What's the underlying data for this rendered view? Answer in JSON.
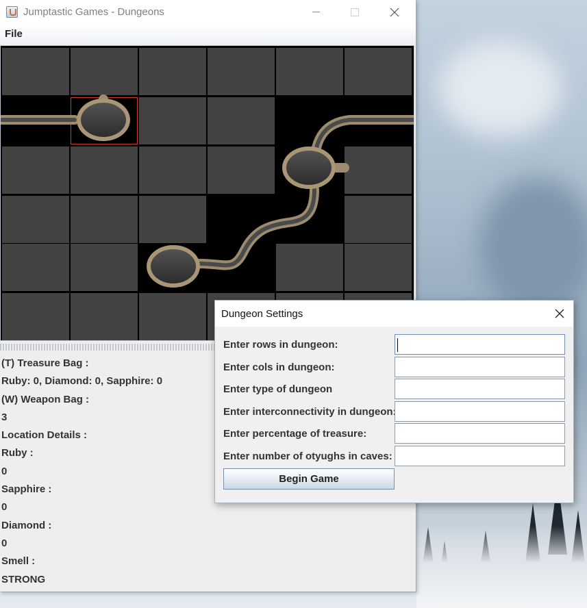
{
  "window": {
    "title": "Jumptastic Games - Dungeons",
    "menu": {
      "file_label": "File"
    }
  },
  "board": {
    "rows": 6,
    "cols": 6,
    "tile_color": "#434343",
    "highlight_color": "#d23a2a"
  },
  "info_panel": {
    "lines": [
      "(T) Treasure Bag :",
      "Ruby: 0, Diamond: 0, Sapphire: 0",
      "(W) Weapon Bag :",
      "3",
      "Location Details :",
      "Ruby :",
      "0",
      "Sapphire :",
      "0",
      "Diamond :",
      "0",
      "Smell :",
      "STRONG"
    ]
  },
  "dialog": {
    "title": "Dungeon Settings",
    "fields": [
      {
        "label": "Enter rows in dungeon:",
        "value": ""
      },
      {
        "label": "Enter cols in dungeon:",
        "value": ""
      },
      {
        "label": "Enter type of dungeon",
        "value": ""
      },
      {
        "label": "Enter interconnectivity in dungeon:",
        "value": ""
      },
      {
        "label": "Enter percentage of treasure:",
        "value": ""
      },
      {
        "label": "Enter number of otyughs in caves:",
        "value": ""
      }
    ],
    "begin_button": "Begin Game"
  }
}
